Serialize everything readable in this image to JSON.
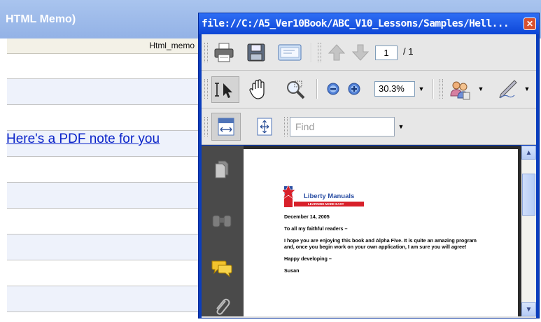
{
  "background": {
    "form_title": "HTML Memo)",
    "grid_column_header": "Html_memo",
    "memo_link_text": "Here's a PDF note for you",
    "row_count": 10
  },
  "pdf_window": {
    "title": "file://C:/A5_Ver10Book/ABC_V10_Lessons/Samples/Hell...",
    "close_label": "✕",
    "toolbar": {
      "page_current": "1",
      "page_total": "/ 1",
      "zoom_value": "30.3%",
      "find_placeholder": "Find"
    },
    "icons": [
      "print-icon",
      "save-icon",
      "email-icon",
      "previous-page-icon",
      "next-page-icon",
      "select-tool-icon",
      "hand-tool-icon",
      "zoom-marquee-icon",
      "zoom-out-icon",
      "zoom-in-icon",
      "review-icon",
      "sign-icon",
      "fit-width-icon",
      "fit-page-icon",
      "pages-panel-icon",
      "search-panel-icon",
      "comments-panel-icon",
      "attachments-panel-icon"
    ],
    "document": {
      "logo_brand": "Liberty Manuals",
      "logo_tagline": "LEARNING MADE EASY",
      "date": "December 14, 2005",
      "salutation": "To all my faithful readers –",
      "body": "I hope you are enjoying this book and Alpha Five. It is quite an amazing program and, once you begin work on your own application, I am sure you will agree!",
      "closing": "Happy developing –",
      "signature": "Susan"
    }
  },
  "colors": {
    "titlebar": "#0d46d6",
    "link": "#0a23c9",
    "form_header": "#a9c4ee",
    "logo_red": "#d8202a",
    "logo_blue": "#2a4ea3"
  }
}
